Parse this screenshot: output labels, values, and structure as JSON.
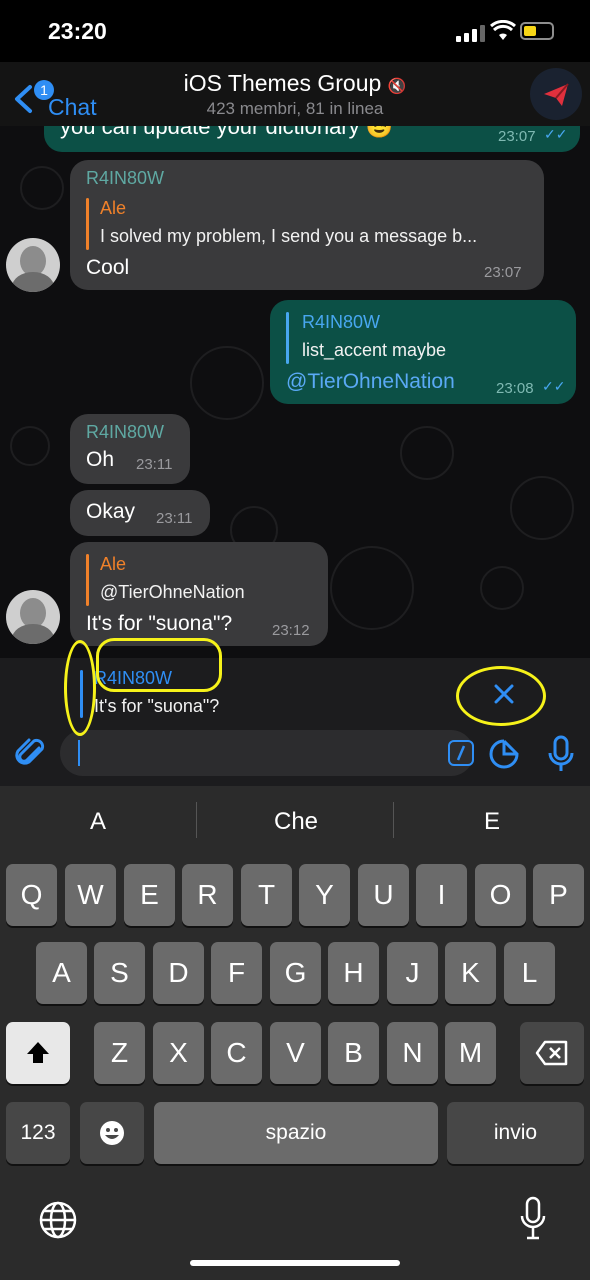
{
  "status_bar": {
    "time": "23:20"
  },
  "header": {
    "back_label": "Chat",
    "back_badge": "1",
    "title": "iOS Themes Group",
    "subtitle": "423 membri, 81 in linea"
  },
  "messages": {
    "top_partial": {
      "text": "you can update your dictionary 😉",
      "time": "23:07"
    },
    "m1": {
      "sender": "R4IN80W",
      "reply_name": "Ale",
      "reply_text": "I solved my problem, I send you a message b...",
      "text": "Cool",
      "time": "23:07"
    },
    "m2": {
      "reply_name": "R4IN80W",
      "reply_text": "list_accent maybe",
      "text": "@TierOhneNation",
      "time": "23:08"
    },
    "m3": {
      "sender": "R4IN80W",
      "text": "Oh",
      "time": "23:11"
    },
    "m4": {
      "text": "Okay",
      "time": "23:11"
    },
    "m5": {
      "reply_name": "Ale",
      "reply_text": "@TierOhneNation",
      "text": "It's for \"suona\"?",
      "time": "23:12"
    }
  },
  "reply_preview": {
    "name": "R4IN80W",
    "text": "It's for \"suona\"?"
  },
  "composer": {
    "value": "",
    "placeholder": ""
  },
  "keyboard": {
    "suggestions": [
      "A",
      "Che",
      "E"
    ],
    "row1": [
      "Q",
      "W",
      "E",
      "R",
      "T",
      "Y",
      "U",
      "I",
      "O",
      "P"
    ],
    "row2": [
      "A",
      "S",
      "D",
      "F",
      "G",
      "H",
      "J",
      "K",
      "L"
    ],
    "row3": [
      "Z",
      "X",
      "C",
      "V",
      "B",
      "N",
      "M"
    ],
    "numbers_label": "123",
    "space_label": "spazio",
    "return_label": "invio"
  },
  "colors": {
    "accent": "#2f8ef4",
    "outgoing_bubble": "#0c5046",
    "incoming_bubble": "#3a3a3c",
    "reply_orange": "#f0812a",
    "annotation_yellow": "#f6f21a"
  }
}
